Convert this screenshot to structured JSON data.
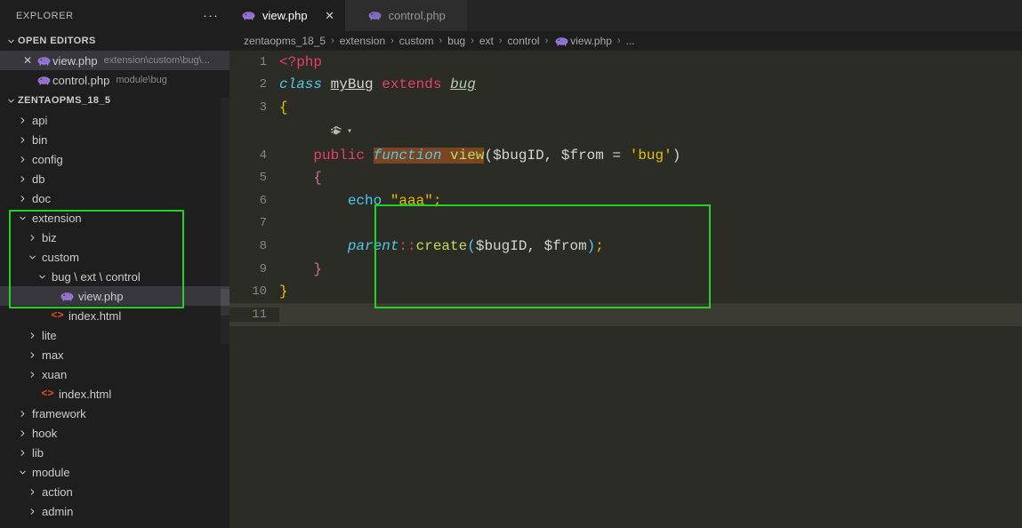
{
  "sidebar": {
    "header": {
      "title": "EXPLORER",
      "more_icon": "kebab-menu-icon"
    },
    "open_editors": {
      "label": "OPEN EDITORS",
      "items": [
        {
          "name": "view.php",
          "desc": "extension\\custom\\bug\\...",
          "icon": "php-icon",
          "has_close": true,
          "selected": true
        },
        {
          "name": "control.php",
          "desc": "module\\bug",
          "icon": "php-icon",
          "has_close": false,
          "selected": false
        }
      ]
    },
    "project": {
      "label": "ZENTAOPMS_18_5",
      "tree": [
        {
          "label": "api",
          "type": "folder",
          "state": "collapsed",
          "depth": 1
        },
        {
          "label": "bin",
          "type": "folder",
          "state": "collapsed",
          "depth": 1
        },
        {
          "label": "config",
          "type": "folder",
          "state": "collapsed",
          "depth": 1
        },
        {
          "label": "db",
          "type": "folder",
          "state": "collapsed",
          "depth": 1
        },
        {
          "label": "doc",
          "type": "folder",
          "state": "collapsed",
          "depth": 1
        },
        {
          "label": "extension",
          "type": "folder",
          "state": "expanded",
          "depth": 1
        },
        {
          "label": "biz",
          "type": "folder",
          "state": "collapsed",
          "depth": 2
        },
        {
          "label": "custom",
          "type": "folder",
          "state": "expanded",
          "depth": 2
        },
        {
          "label": "bug \\ ext \\ control",
          "type": "folder",
          "state": "expanded",
          "depth": 3
        },
        {
          "label": "view.php",
          "type": "php",
          "state": "file",
          "depth": 4,
          "selected": true
        },
        {
          "label": "index.html",
          "type": "html",
          "state": "file",
          "depth": 3
        },
        {
          "label": "lite",
          "type": "folder",
          "state": "collapsed",
          "depth": 2
        },
        {
          "label": "max",
          "type": "folder",
          "state": "collapsed",
          "depth": 2
        },
        {
          "label": "xuan",
          "type": "folder",
          "state": "collapsed",
          "depth": 2
        },
        {
          "label": "index.html",
          "type": "html",
          "state": "file",
          "depth": 2
        },
        {
          "label": "framework",
          "type": "folder",
          "state": "collapsed",
          "depth": 1
        },
        {
          "label": "hook",
          "type": "folder",
          "state": "collapsed",
          "depth": 1
        },
        {
          "label": "lib",
          "type": "folder",
          "state": "collapsed",
          "depth": 1
        },
        {
          "label": "module",
          "type": "folder",
          "state": "expanded",
          "depth": 1
        },
        {
          "label": "action",
          "type": "folder",
          "state": "collapsed",
          "depth": 2
        },
        {
          "label": "admin",
          "type": "folder",
          "state": "collapsed",
          "depth": 2
        }
      ]
    }
  },
  "tabs": [
    {
      "label": "view.php",
      "icon": "php-icon",
      "active": true,
      "close_icon": "close-icon"
    },
    {
      "label": "control.php",
      "icon": "php-icon",
      "active": false,
      "close_icon": null
    }
  ],
  "breadcrumbs": [
    {
      "label": "zentaopms_18_5",
      "icon": null
    },
    {
      "label": "extension",
      "icon": null
    },
    {
      "label": "custom",
      "icon": null
    },
    {
      "label": "bug",
      "icon": null
    },
    {
      "label": "ext",
      "icon": null
    },
    {
      "label": "control",
      "icon": null
    },
    {
      "label": "view.php",
      "icon": "php-icon"
    },
    {
      "label": "...",
      "icon": null
    }
  ],
  "editor": {
    "codelens": {
      "icon": "codelens-stack-icon",
      "chevron": "chevron-down-icon"
    },
    "line_numbers": [
      "1",
      "2",
      "3",
      "4",
      "5",
      "6",
      "7",
      "8",
      "9",
      "10",
      "11"
    ],
    "lines": [
      "<?php",
      "class myBug extends bug",
      "{",
      "    public function view($bugID, $from = 'bug')",
      "    {",
      "        echo \"aaa\";",
      "",
      "        parent::create($bugID, $from);",
      "    }",
      "}",
      ""
    ],
    "current_line": 11,
    "find_match_text": "function view"
  },
  "colors": {
    "annotation_green": "#22d422",
    "find_highlight": "#7a4520",
    "editor_background": "#2c2c26",
    "sidebar_background": "#1e1e1e",
    "selection": "#37373d",
    "current_line": "#3b3b33"
  }
}
